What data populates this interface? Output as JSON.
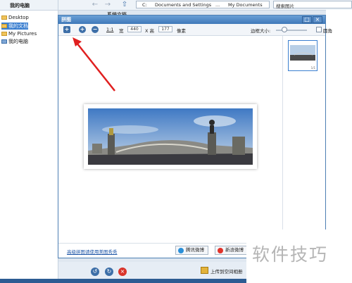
{
  "tree": {
    "title": "我的电脑",
    "items": [
      {
        "label": "Desktop",
        "selected": false
      },
      {
        "label": "我的文档",
        "selected": true
      },
      {
        "label": "My Pictures",
        "selected": false
      },
      {
        "label": "我的电脑",
        "selected": false
      }
    ]
  },
  "address": {
    "segments": [
      "C:",
      "Documents and Settings",
      "...",
      "My Documents"
    ]
  },
  "search": {
    "placeholder": "搜索图片"
  },
  "explorer": {
    "folder_title": "系统文档"
  },
  "dialog": {
    "title": "拼图",
    "toolbar": {
      "zoom_label": "1:1",
      "width_label": "宽",
      "width_value": "440",
      "x_height_label": "X 高",
      "height_value": "177",
      "unit_label": "像素",
      "border_label": "边框大小:",
      "rounded_label": "圆角",
      "border_level": 0.27
    },
    "thumb_caption": "1/1",
    "link": "高级拼图请使用美图秀秀",
    "share_qq": "腾讯微博",
    "share_sina": "新浪微博"
  },
  "bottombar": {
    "upload_label": "上传到空间相册"
  },
  "watermark": "软件技巧",
  "colors": {
    "accent": "#3b7fd0",
    "arrow": "#e02020",
    "title_bar": "#4f86c3"
  }
}
